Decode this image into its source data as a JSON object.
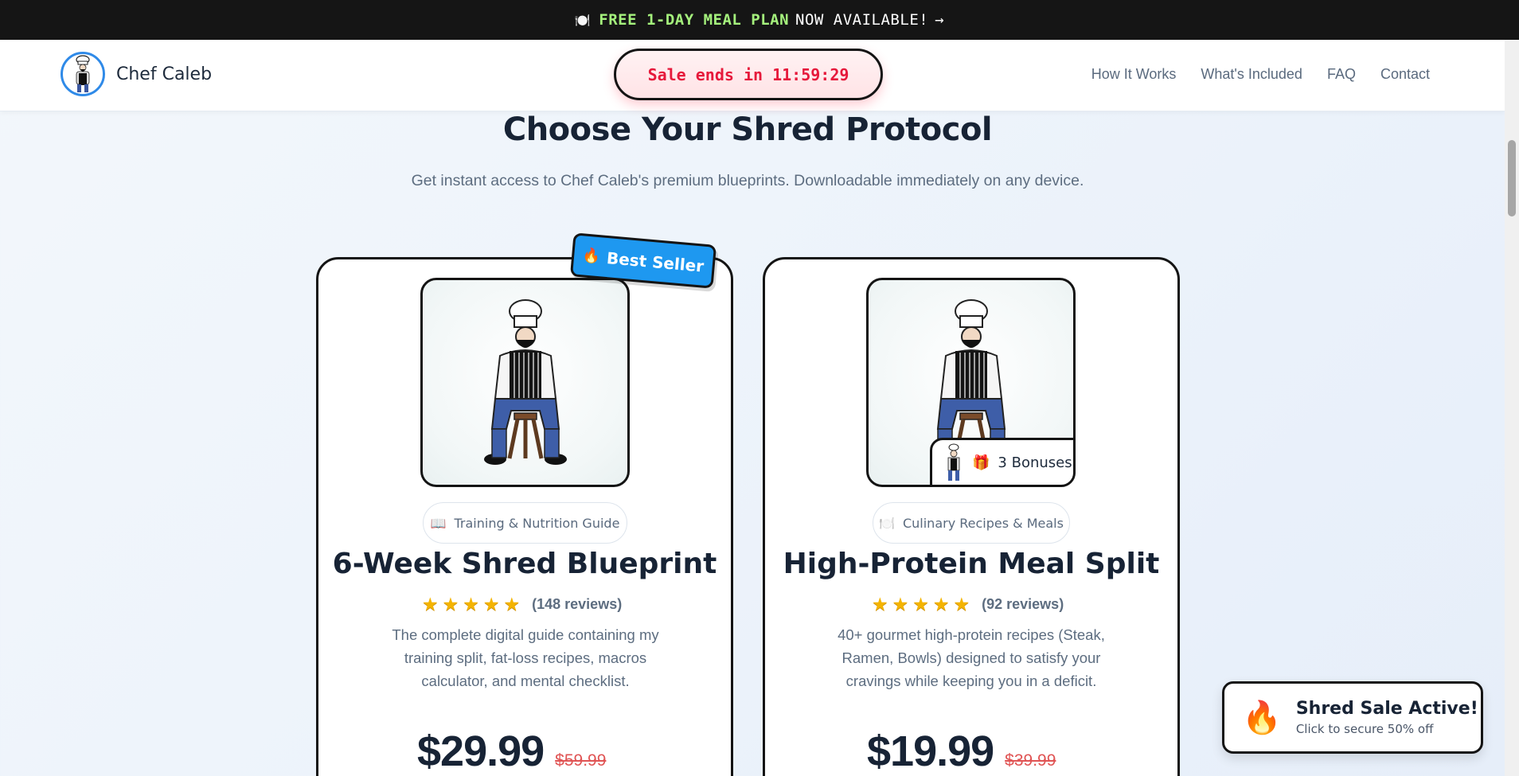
{
  "announcement": {
    "icon": "plate-icon",
    "highlight": "FREE 1-DAY MEAL PLAN",
    "text": "NOW AVAILABLE!",
    "arrow": "→"
  },
  "header": {
    "brand": "Chef Caleb",
    "sale_label": "Sale ends in 11:59:29",
    "nav": [
      "How It Works",
      "What's Included",
      "FAQ",
      "Contact"
    ]
  },
  "section": {
    "title": "Choose Your Shred Protocol",
    "subtitle": "Get instant access to Chef Caleb's premium blueprints. Downloadable immediately on any device."
  },
  "products": [
    {
      "badge": "Best Seller",
      "category_icon": "book-icon",
      "category": "Training & Nutrition Guide",
      "title": "6-Week Shred Blueprint",
      "rating": 5,
      "reviews": "(148 reviews)",
      "description": "The complete digital guide containing my training split, fat-loss recipes, macros calculator, and mental checklist.",
      "price": "$29.99",
      "old_price": "$59.99"
    },
    {
      "bonus": "3 Bonuses",
      "category_icon": "plate-icon",
      "category": "Culinary Recipes & Meals",
      "title": "High-Protein Meal Split",
      "rating": 5,
      "reviews": "(92 reviews)",
      "description": "40+ gourmet high-protein recipes (Steak, Ramen, Bowls) designed to satisfy your cravings while keeping you in a deficit.",
      "price": "$19.99",
      "old_price": "$39.99"
    }
  ],
  "toast": {
    "title": "Shred Sale Active!",
    "subtitle": "Click to secure 50% off"
  },
  "colors": {
    "accent_blue": "#1e98f0",
    "sale_red": "#e6193b",
    "highlight_green": "#a4f07c",
    "strike_red": "#e05454"
  }
}
